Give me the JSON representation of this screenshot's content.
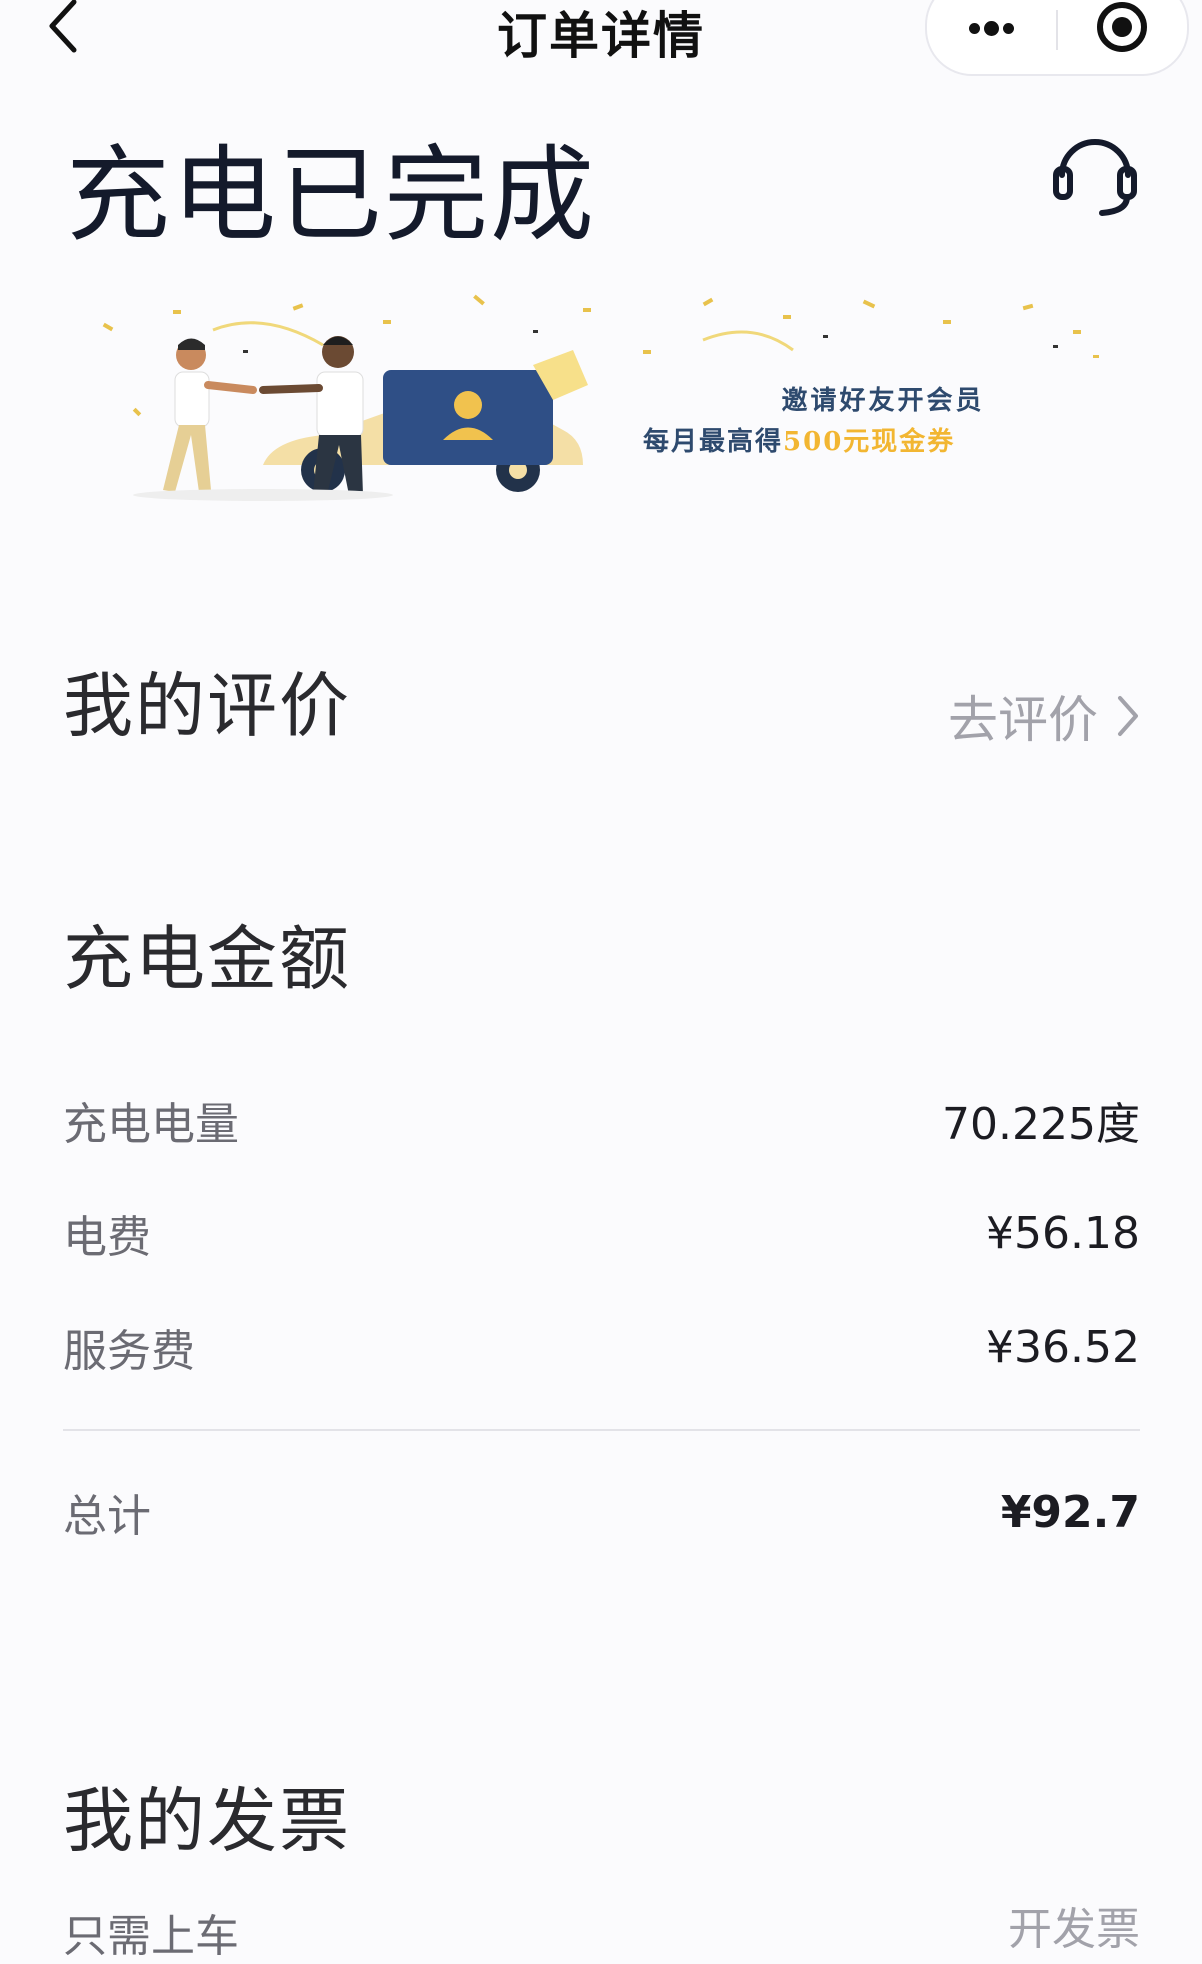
{
  "nav": {
    "title": "订单详情"
  },
  "status": {
    "title": "充电已完成"
  },
  "banner": {
    "line1": "邀请好友开会员",
    "line2_prefix": "每月最高得",
    "line2_highlight": "500元现金券"
  },
  "review": {
    "section_title": "我的评价",
    "action_label": "去评价"
  },
  "charge": {
    "section_title": "充电金额",
    "rows": [
      {
        "label": "充电电量",
        "value": "70.225度"
      },
      {
        "label": "电费",
        "value": "¥56.18"
      },
      {
        "label": "服务费",
        "value": "¥36.52"
      }
    ],
    "total_label": "总计",
    "total_value": "¥92.7"
  },
  "invoice": {
    "section_title": "我的发票",
    "row_label": "只需上车",
    "action_label": "开发票"
  },
  "colors": {
    "accent_text": "#141a2b",
    "muted": "#a2a2aa",
    "banner_blue": "#2e4a6e",
    "banner_gold": "#f2b632"
  }
}
